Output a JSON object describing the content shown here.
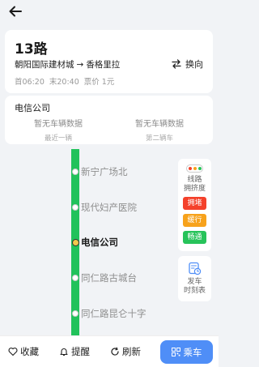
{
  "route": {
    "name": "13路",
    "from": "朝阳国际建材城",
    "arrow": "→",
    "to": "香格里拉",
    "first_bus": "首06:20",
    "last_bus": "末20:40",
    "fare": "票价 1元",
    "swap_label": "换向"
  },
  "station": {
    "name": "电信公司",
    "buses": [
      {
        "status": "暂无车辆数据",
        "label": "最近一辆"
      },
      {
        "status": "暂无车辆数据",
        "label": "第二辆车"
      }
    ]
  },
  "stops": [
    {
      "name": "新宁广场北",
      "current": false
    },
    {
      "name": "现代妇产医院",
      "current": false
    },
    {
      "name": "电信公司",
      "current": true
    },
    {
      "name": "同仁路古城台",
      "current": false
    },
    {
      "name": "同仁路昆仑十字",
      "current": false
    }
  ],
  "congestion": {
    "title_line1": "线路",
    "title_line2": "拥挤度",
    "levels": [
      {
        "label": "拥堵",
        "color": "#f4412b"
      },
      {
        "label": "缓行",
        "color": "#f7a21b"
      },
      {
        "label": "畅通",
        "color": "#27c35a"
      }
    ]
  },
  "timetable": {
    "line1": "发车",
    "line2": "时刻表"
  },
  "bottom": {
    "favorite_label": "收藏",
    "remind_label": "提醒",
    "refresh_label": "刷新",
    "ride_label": "乘车"
  },
  "colors": {
    "line": "#21c25b",
    "accent": "#4f8ef7"
  }
}
